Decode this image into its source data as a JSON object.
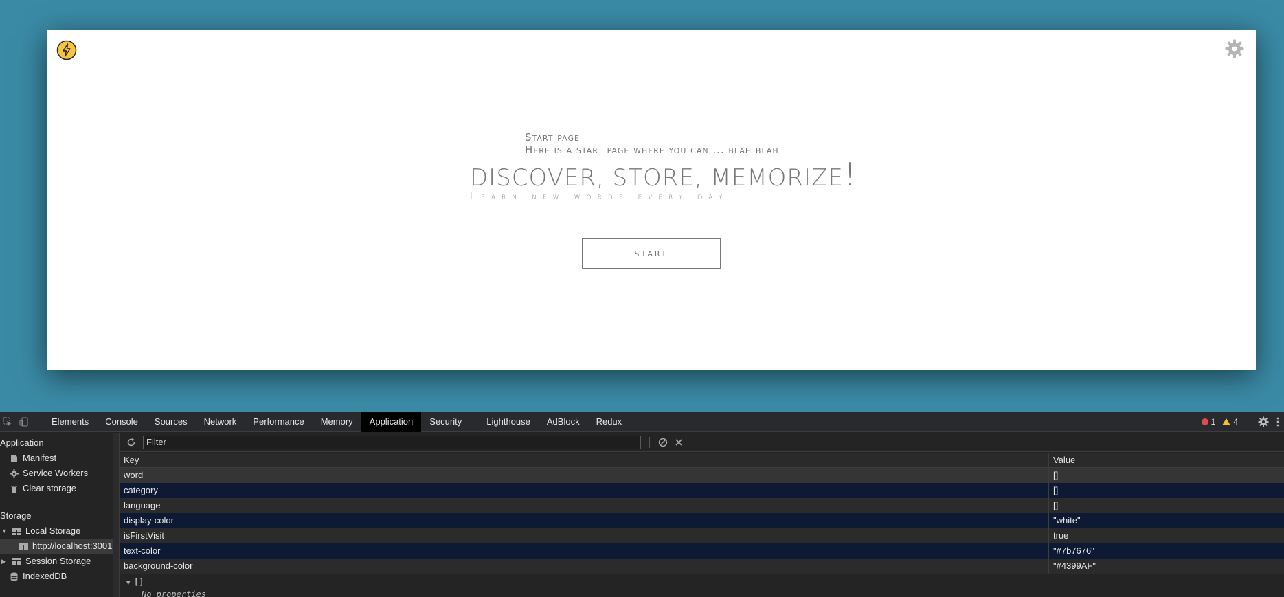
{
  "app": {
    "intro_line1": "Start page",
    "intro_line2": "Here is a start page where you can ... blah blah",
    "hero_title": "DISCOVER, STORE, MEMORIZE",
    "hero_bang": "!",
    "hero_sub": "Learn new words every day",
    "start_label": "START",
    "colors": {
      "text": "#7b7676",
      "background": "#4399AF"
    }
  },
  "devtools": {
    "tabs": [
      {
        "label": "Elements"
      },
      {
        "label": "Console"
      },
      {
        "label": "Sources"
      },
      {
        "label": "Network"
      },
      {
        "label": "Performance"
      },
      {
        "label": "Memory"
      },
      {
        "label": "Application",
        "active": true
      },
      {
        "label": "Security"
      },
      {
        "label": "Lighthouse"
      },
      {
        "label": "AdBlock"
      },
      {
        "label": "Redux"
      }
    ],
    "error_count": "1",
    "warning_count": "4",
    "sidebar": {
      "application_header": "Application",
      "manifest": "Manifest",
      "service_workers": "Service Workers",
      "clear_storage": "Clear storage",
      "storage_header": "Storage",
      "local_storage": "Local Storage",
      "local_origin": "http://localhost:3001",
      "session_storage": "Session Storage",
      "indexeddb": "IndexedDB"
    },
    "filter_placeholder": "Filter",
    "table": {
      "col_key": "Key",
      "col_value": "Value",
      "rows": [
        {
          "key": "word",
          "value": "[]"
        },
        {
          "key": "category",
          "value": "[]"
        },
        {
          "key": "language",
          "value": "[]"
        },
        {
          "key": "display-color",
          "value": "\"white\""
        },
        {
          "key": "isFirstVisit",
          "value": "true"
        },
        {
          "key": "text-color",
          "value": "\"#7b7676\""
        },
        {
          "key": "background-color",
          "value": "\"#4399AF\""
        }
      ]
    },
    "preview": {
      "root": "[]",
      "sub": "No properties"
    }
  }
}
